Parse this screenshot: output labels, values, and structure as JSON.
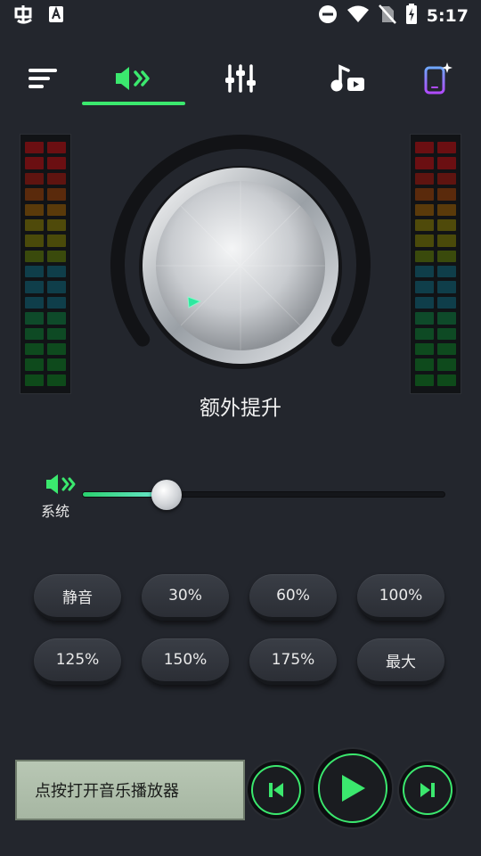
{
  "status_bar": {
    "time": "5:17",
    "left_icons": [
      "app-logo-icon",
      "font-icon"
    ],
    "right_icons": [
      "dnd-icon",
      "wifi-icon",
      "no-sim-icon",
      "battery-charging-icon"
    ]
  },
  "nav": {
    "items": [
      {
        "name": "menu",
        "icon": "menu-icon"
      },
      {
        "name": "volume-boost",
        "icon": "speaker-boost-icon",
        "active": true
      },
      {
        "name": "equalizer",
        "icon": "equalizer-icon"
      },
      {
        "name": "music",
        "icon": "music-video-icon"
      },
      {
        "name": "device",
        "icon": "phone-sparkle-icon"
      }
    ],
    "accent": "#3be86e"
  },
  "knob": {
    "title": "额外提升",
    "indicator_color": "#2ee8a0"
  },
  "volume": {
    "label": "系统",
    "level_percent": 23
  },
  "presets": [
    "静音",
    "30%",
    "60%",
    "100%",
    "125%",
    "150%",
    "175%",
    "最大"
  ],
  "player": {
    "label": "点按打开音乐播放器",
    "buttons": [
      "previous-icon",
      "play-icon",
      "next-icon"
    ]
  }
}
